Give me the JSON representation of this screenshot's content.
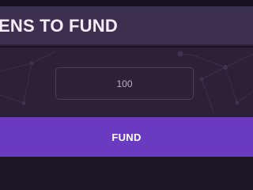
{
  "header": {
    "title": "ENS TO FUND"
  },
  "amount_input": {
    "value": "100"
  },
  "fund_button": {
    "label": "FUND"
  },
  "colors": {
    "header_bg": "#3c3050",
    "panel_bg": "#2c2238",
    "button_bg": "#6a3bc0",
    "page_bg": "#1b1526"
  }
}
